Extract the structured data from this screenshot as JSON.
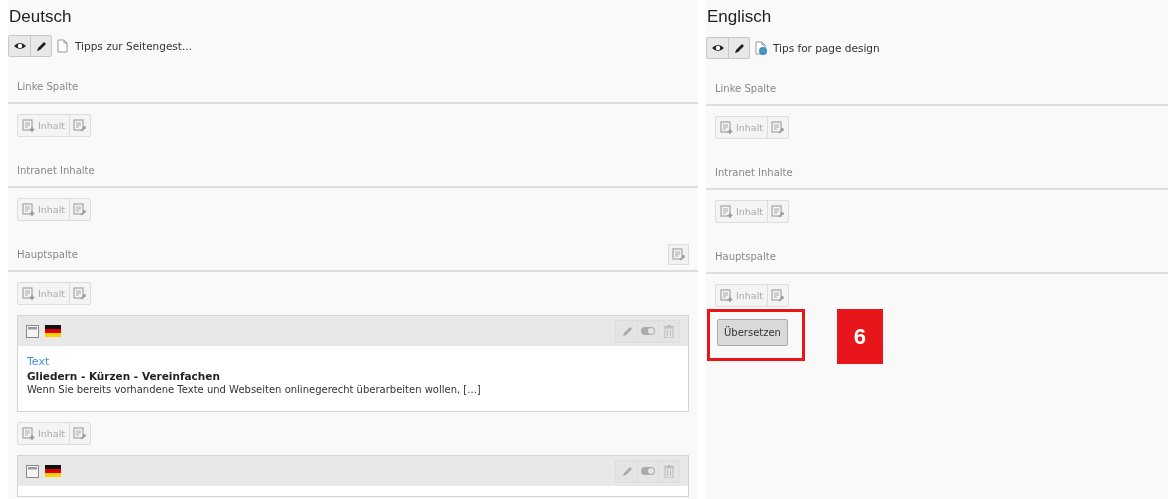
{
  "columns": [
    {
      "language": "Deutsch",
      "page": {
        "title": "Tipps zur Seitengest..."
      },
      "sections": [
        {
          "name": "Linke Spalte",
          "paste_button": false,
          "blocks": [
            {
              "kind": "new",
              "label": "Inhalt"
            }
          ]
        },
        {
          "name": "Intranet Inhalte",
          "paste_button": false,
          "blocks": [
            {
              "kind": "new",
              "label": "Inhalt"
            }
          ]
        },
        {
          "name": "Hauptspalte",
          "paste_button": true,
          "blocks": [
            {
              "kind": "new",
              "label": "Inhalt"
            },
            {
              "kind": "record",
              "type": "Text",
              "header": "Gliedern - Kürzen - Vereinfachen",
              "text": "Wenn Sie bereits vorhandene Texte und Webseiten onlinegerecht überarbeiten wollen, [...]"
            },
            {
              "kind": "new",
              "label": "Inhalt"
            },
            {
              "kind": "record"
            }
          ]
        }
      ]
    },
    {
      "language": "Englisch",
      "page": {
        "title": "Tips for page design"
      },
      "sections": [
        {
          "name": "Linke Spalte",
          "paste_button": false,
          "blocks": [
            {
              "kind": "new",
              "label": "Inhalt"
            }
          ]
        },
        {
          "name": "Intranet Inhalte",
          "paste_button": false,
          "blocks": [
            {
              "kind": "new",
              "label": "Inhalt"
            }
          ]
        },
        {
          "name": "Hauptspalte",
          "paste_button": false,
          "blocks": [
            {
              "kind": "new",
              "label": "Inhalt"
            },
            {
              "kind": "translate",
              "label": "Übersetzen",
              "highlighted": true,
              "badge": "6"
            }
          ]
        }
      ]
    }
  ]
}
